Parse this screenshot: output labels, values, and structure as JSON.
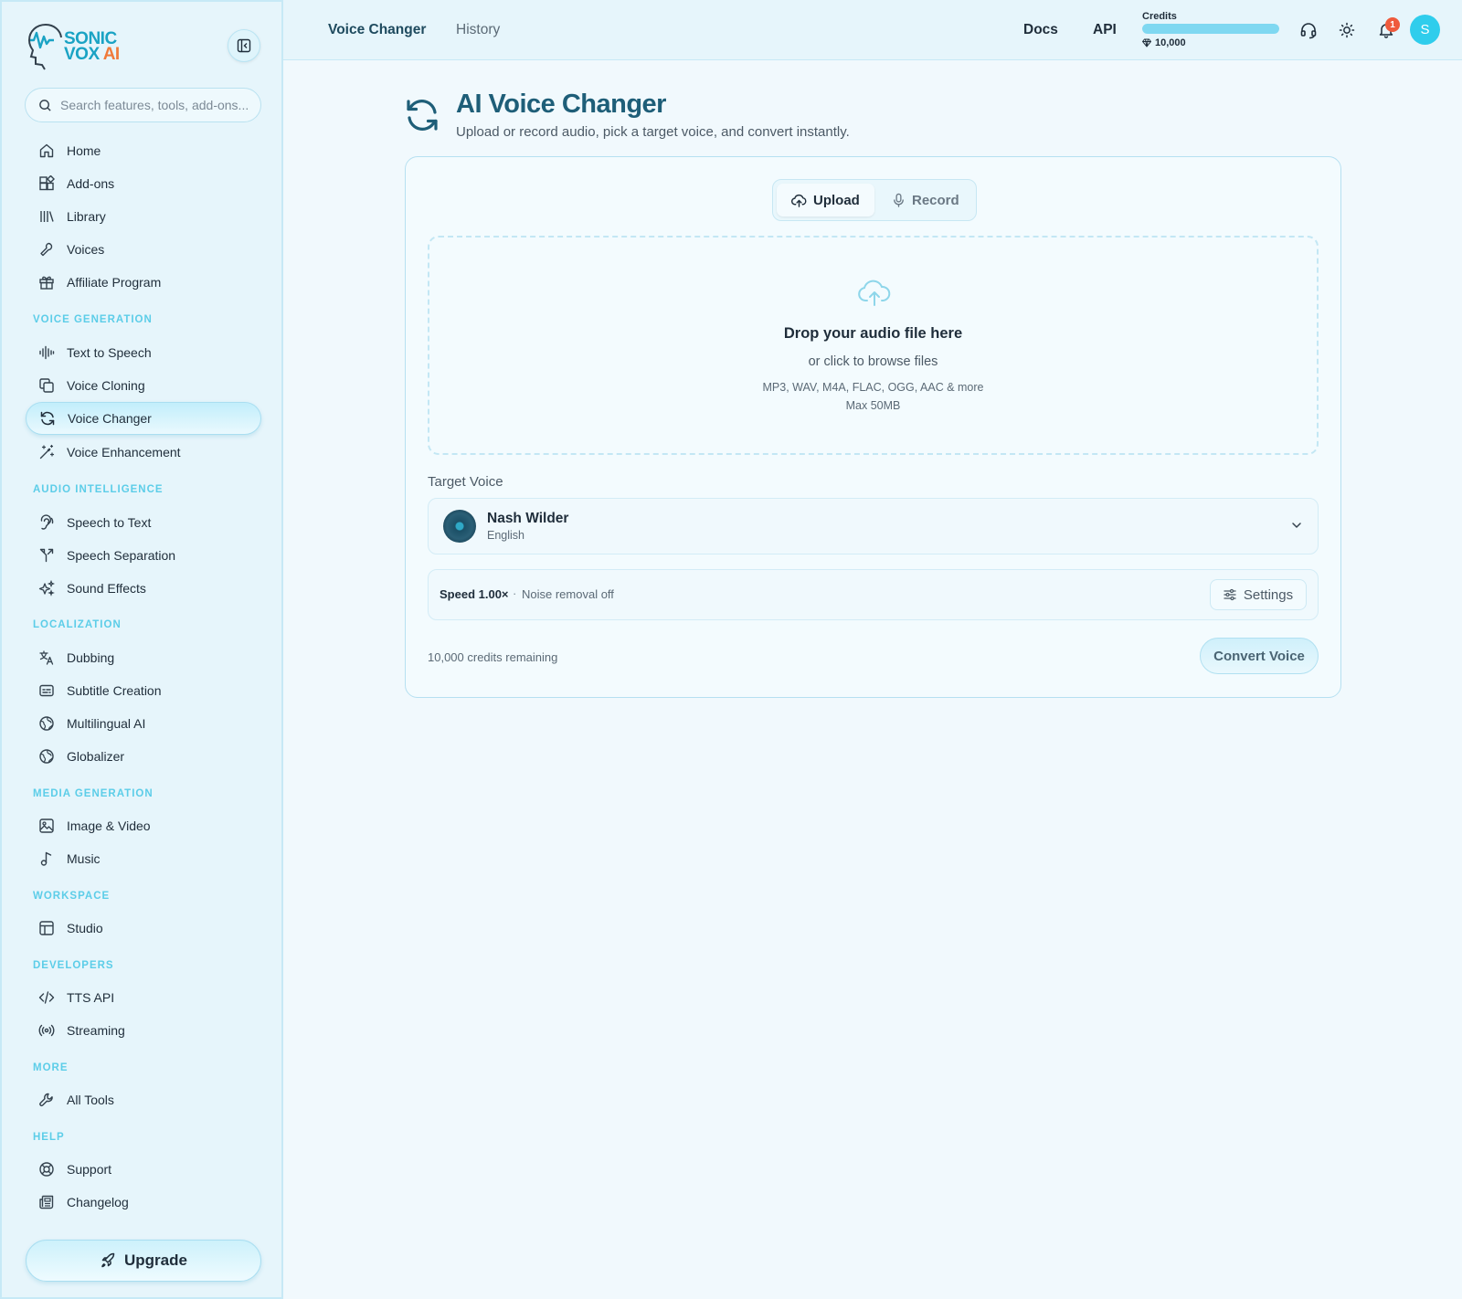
{
  "brand": {
    "line1": "SONIC",
    "line2": "VOX",
    "line2_accent": "AI"
  },
  "search": {
    "placeholder": "Search features, tools, add-ons..."
  },
  "nav": {
    "top": [
      {
        "label": "Home",
        "icon": "home-icon"
      },
      {
        "label": "Add-ons",
        "icon": "add-ons-icon"
      },
      {
        "label": "Library",
        "icon": "library-icon"
      },
      {
        "label": "Voices",
        "icon": "voices-icon"
      },
      {
        "label": "Affiliate Program",
        "icon": "gift-icon"
      }
    ],
    "sections": [
      {
        "title": "VOICE GENERATION",
        "items": [
          {
            "label": "Text to Speech",
            "icon": "waveform-icon"
          },
          {
            "label": "Voice Cloning",
            "icon": "copy-icon"
          },
          {
            "label": "Voice Changer",
            "icon": "refresh-icon",
            "active": true
          },
          {
            "label": "Voice Enhancement",
            "icon": "magic-wand-icon"
          }
        ]
      },
      {
        "title": "AUDIO INTELLIGENCE",
        "items": [
          {
            "label": "Speech to Text",
            "icon": "ear-icon"
          },
          {
            "label": "Speech Separation",
            "icon": "split-icon"
          },
          {
            "label": "Sound Effects",
            "icon": "sparkles-icon"
          }
        ]
      },
      {
        "title": "LOCALIZATION",
        "items": [
          {
            "label": "Dubbing",
            "icon": "translate-icon"
          },
          {
            "label": "Subtitle Creation",
            "icon": "subtitles-icon"
          },
          {
            "label": "Multilingual AI",
            "icon": "globe-icon"
          },
          {
            "label": "Globalizer",
            "icon": "globe-icon"
          }
        ]
      },
      {
        "title": "MEDIA GENERATION",
        "items": [
          {
            "label": "Image & Video",
            "icon": "image-icon"
          },
          {
            "label": "Music",
            "icon": "music-icon"
          }
        ]
      },
      {
        "title": "WORKSPACE",
        "items": [
          {
            "label": "Studio",
            "icon": "layout-icon"
          }
        ]
      },
      {
        "title": "DEVELOPERS",
        "items": [
          {
            "label": "TTS API",
            "icon": "code-icon"
          },
          {
            "label": "Streaming",
            "icon": "broadcast-icon"
          }
        ]
      },
      {
        "title": "MORE",
        "items": [
          {
            "label": "All Tools",
            "icon": "wrench-icon"
          }
        ]
      },
      {
        "title": "HELP",
        "items": [
          {
            "label": "Support",
            "icon": "lifebuoy-icon"
          },
          {
            "label": "Changelog",
            "icon": "newspaper-icon"
          }
        ]
      }
    ]
  },
  "upgrade": {
    "label": "Upgrade",
    "icon": "rocket-icon"
  },
  "topbar": {
    "tabs": [
      {
        "label": "Voice Changer",
        "active": true
      },
      {
        "label": "History",
        "active": false
      }
    ],
    "links": [
      "Docs",
      "API"
    ],
    "credits": {
      "label": "Credits",
      "value": "10,000",
      "fill_fraction": 1.0
    },
    "notifications_count": "1",
    "avatar_initial": "S"
  },
  "page": {
    "title": "AI Voice Changer",
    "subtitle": "Upload or record audio, pick a target voice, and convert instantly.",
    "mode_tabs": [
      {
        "label": "Upload",
        "active": true
      },
      {
        "label": "Record",
        "active": false
      }
    ],
    "dropzone": {
      "title": "Drop your audio file here",
      "subtitle": "or click to browse files",
      "formats": "MP3, WAV, M4A, FLAC, OGG, AAC & more",
      "max": "Max 50MB"
    },
    "target_voice": {
      "label": "Target Voice",
      "name": "Nash Wilder",
      "language": "English"
    },
    "settings_summary": {
      "speed": "Speed 1.00×",
      "separator": "·",
      "noise": "Noise removal off",
      "button": "Settings"
    },
    "credits_remaining": "10,000 credits remaining",
    "convert_button": "Convert Voice"
  },
  "colors": {
    "accent": "#2fcdec",
    "title": "#1e5e78",
    "section_label": "#5ccde8",
    "badge": "#ef5a3c"
  }
}
